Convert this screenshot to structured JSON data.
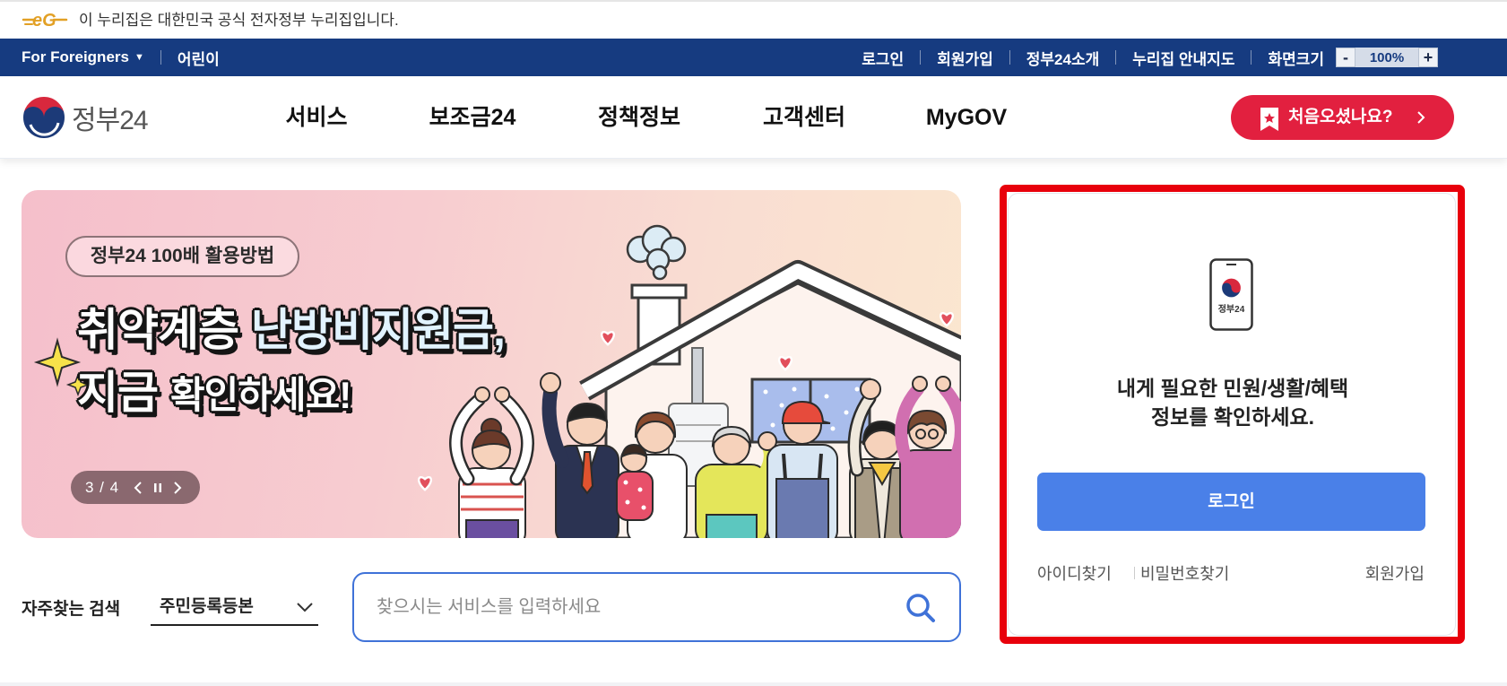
{
  "gov_banner": {
    "logo_text": "eG",
    "notice": "이 누리집은 대한민국 공식 전자정부 누리집입니다."
  },
  "utility_bar": {
    "foreigners": "For Foreigners",
    "kids": "어린이",
    "links": [
      "로그인",
      "회원가입",
      "정부24소개",
      "누리집 안내지도"
    ],
    "zoom_label": "화면크기",
    "zoom_out": "-",
    "zoom_level": "100%",
    "zoom_in": "+"
  },
  "header": {
    "logo_text": "정부24",
    "nav": [
      "서비스",
      "보조금24",
      "정책정보",
      "고객센터",
      "MyGOV"
    ],
    "first_visit_button": "처음오셨나요?"
  },
  "hero": {
    "tag": "정부24 100배 활용방법",
    "headline": {
      "line1_a": "취약계층",
      "line1_b": "난방비지원금,",
      "line2_a": "지금",
      "line2_b": "확인하세요!"
    },
    "pager": "3 / 4"
  },
  "search": {
    "frequent_label": "자주찾는 검색",
    "frequent_selected": "주민등록등본",
    "placeholder": "찾으시는 서비스를 입력하세요"
  },
  "login_panel": {
    "app_label": "정부24",
    "message_line1": "내게 필요한 민원/생활/혜택",
    "message_line2": "정보를 확인하세요.",
    "login_button": "로그인",
    "find_id": "아이디찾기",
    "find_password": "비밀번호찾기",
    "signup": "회원가입"
  },
  "icons": {
    "foreigners_dropdown": "chevron-down-icon",
    "first_visit": "bookmark-icon",
    "first_visit_arrow": "chevron-right-icon",
    "pager_prev": "chevron-left-icon",
    "pager_pause": "pause-icon",
    "pager_next": "chevron-right-icon",
    "frequent_dropdown": "chevron-down-icon",
    "search": "search-icon",
    "login_app": "phone-icon"
  },
  "colors": {
    "utility_bar": "#163b80",
    "brand_red": "#e2203f",
    "primary_blue": "#4a80e8",
    "search_border": "#3f72d8",
    "highlight_box": "#e8000b",
    "hero_pink": "#f5bfcb",
    "hero_peach": "#fbe7cf"
  }
}
